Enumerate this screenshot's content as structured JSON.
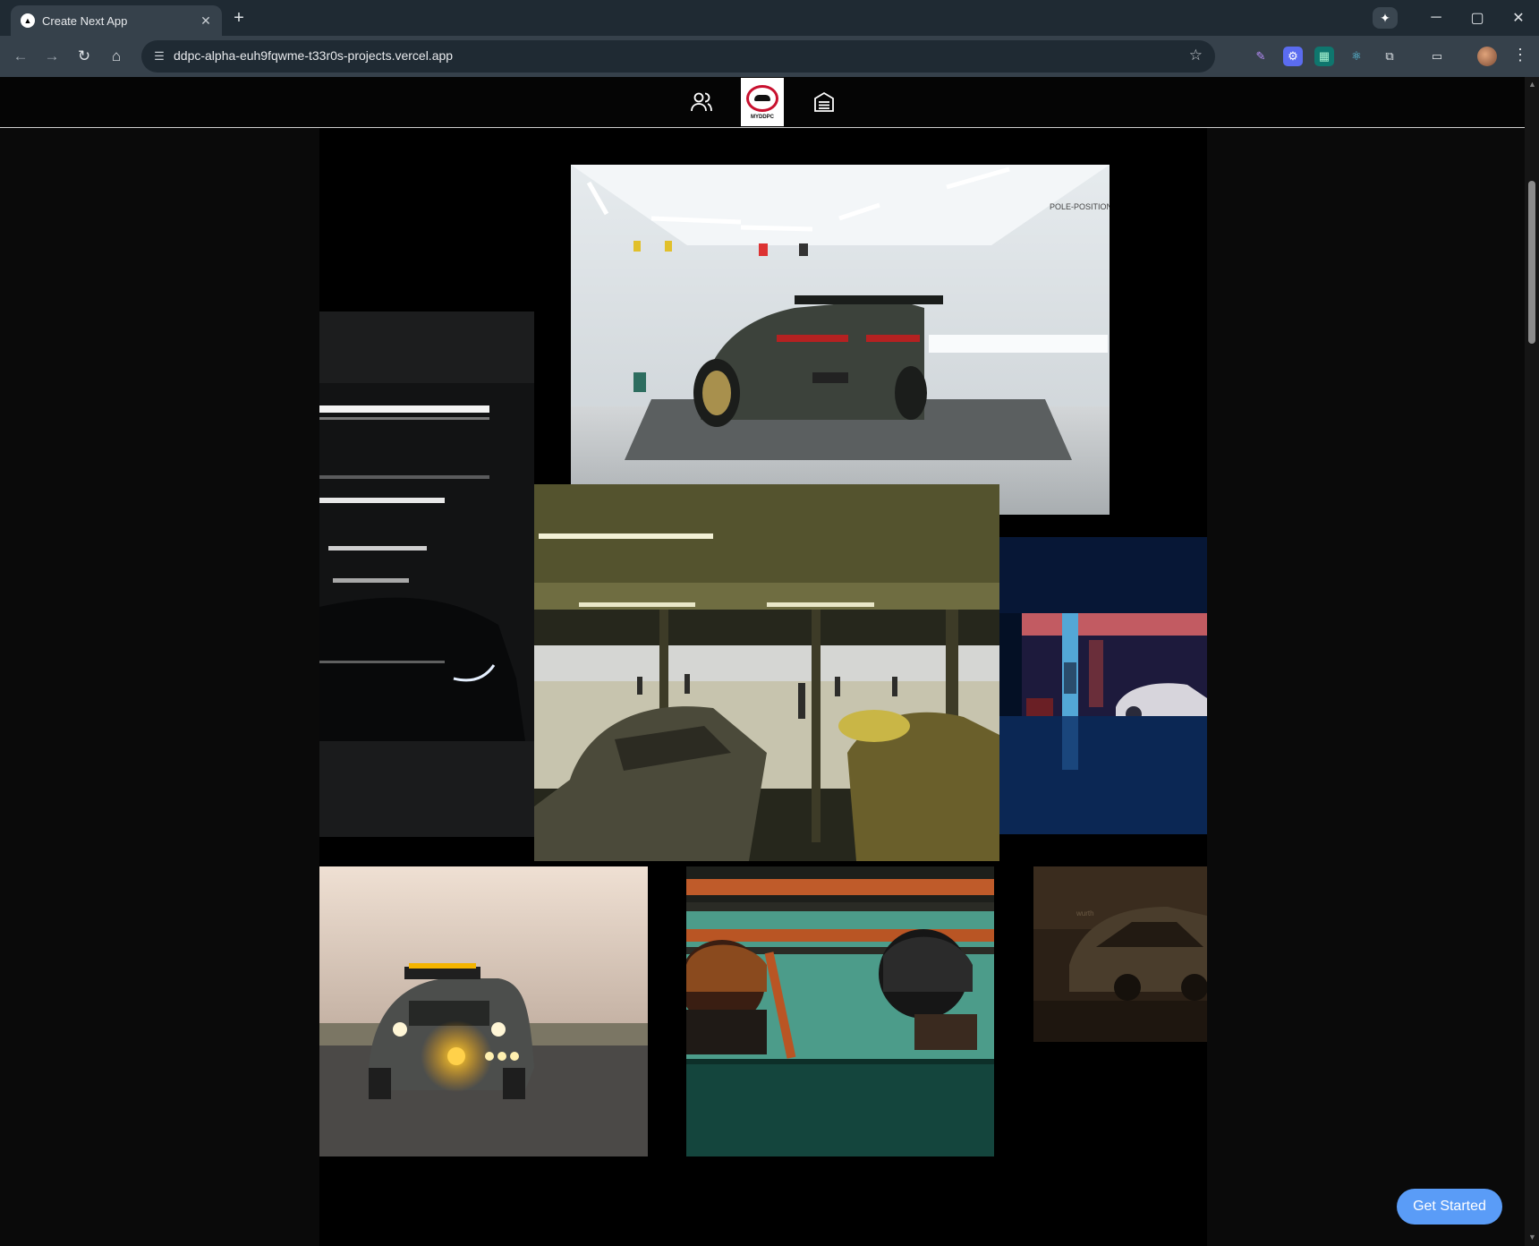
{
  "browser": {
    "tab_title": "Create Next App",
    "url": "ddpc-alpha-euh9fqwme-t33r0s-projects.vercel.app",
    "tab_close": "✕",
    "new_tab": "+",
    "window_minimize": "─",
    "window_maximize": "▢",
    "window_close": "✕"
  },
  "site": {
    "logo_text": "MYDDPC",
    "gallery": [
      {
        "name": "bmw-m2-workshop",
        "desc": "Dark green BMW with rear wing in white garage"
      },
      {
        "name": "dark-audi-garage",
        "desc": "Black car with LED headlights in dark parking garage"
      },
      {
        "name": "race-pit-lane",
        "desc": "Race cars in pit garage facing track"
      },
      {
        "name": "neon-parking",
        "desc": "Car in blue and red neon parking lot"
      },
      {
        "name": "porsche-fog",
        "desc": "Rally SUV with yellow fog lights"
      },
      {
        "name": "racing-drivers",
        "desc": "Two racing drivers in helmets in roll cage"
      },
      {
        "name": "rally-car-night",
        "desc": "Vintage rally car in brown tones"
      }
    ],
    "cta_label": "Get Started"
  }
}
